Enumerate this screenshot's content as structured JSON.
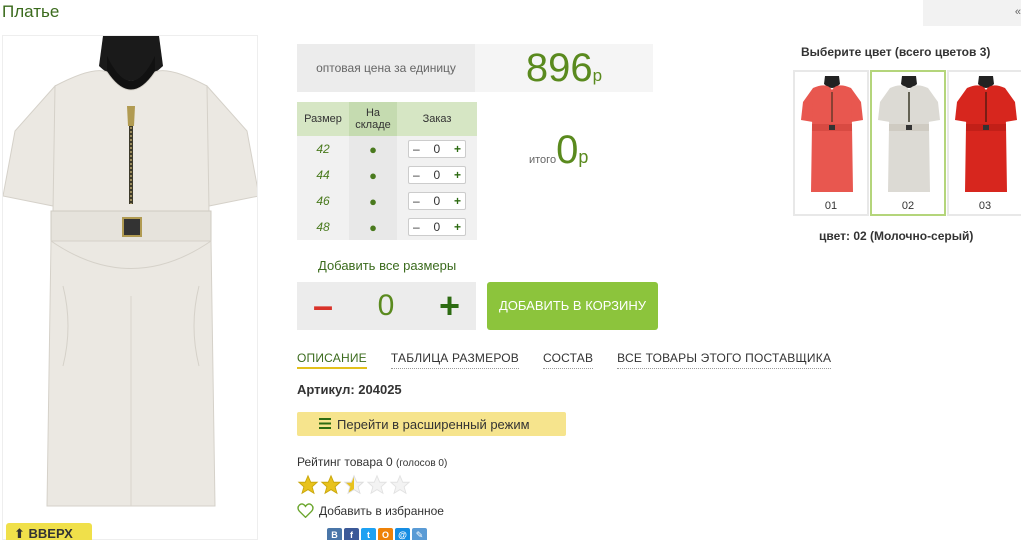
{
  "page": {
    "title": "Платье",
    "top_right_glyph": "«"
  },
  "price": {
    "label": "оптовая цена за единицу",
    "value": "896",
    "currency": "р"
  },
  "size_table": {
    "headers": [
      "Размер",
      "На складе",
      "Заказ"
    ],
    "rows": [
      {
        "size": "42",
        "stock": "●",
        "qty": "0"
      },
      {
        "size": "44",
        "stock": "●",
        "qty": "0"
      },
      {
        "size": "46",
        "stock": "●",
        "qty": "0"
      },
      {
        "size": "48",
        "stock": "●",
        "qty": "0"
      }
    ],
    "minus": "–",
    "plus": "+"
  },
  "total": {
    "label": "итого",
    "value": "0",
    "currency": "р"
  },
  "add_all_sizes": "Добавить все размеры",
  "big_qty": {
    "minus": "–",
    "value": "0",
    "plus": "+"
  },
  "cart_button": "ДОБАВИТЬ В КОРЗИНУ",
  "tabs": [
    "ОПИСАНИЕ",
    "ТАБЛИЦА РАЗМЕРОВ",
    "СОСТАВ",
    "ВСЕ ТОВАРЫ ЭТОГО ПОСТАВЩИКА"
  ],
  "artikul": "Артикул: 204025",
  "advanced_mode_button": "Перейти в расширенный режим",
  "rating": {
    "label": "Рейтинг товара 0",
    "votes": "(голосов 0)",
    "stars_filled": 2.5,
    "stars_total": 5
  },
  "favorite": "Добавить в избранное",
  "back_to_top": "⬆ ВВЕРХ",
  "colors": {
    "title": "Выберите цвет (всего цветов 3)",
    "items": [
      {
        "label": "01",
        "color": "#e8574f"
      },
      {
        "label": "02",
        "color": "#dcdad4"
      },
      {
        "label": "03",
        "color": "#d7261e"
      }
    ],
    "selected_index": 1,
    "selected_caption": "цвет: 02 (Молочно-серый)"
  },
  "social_icons": [
    "В",
    "f",
    "t",
    "О",
    "@",
    "✎"
  ],
  "colors_theme": {
    "accent_green": "#5a8a1e",
    "cart_green": "#8cc43c",
    "minus_red": "#d9332a",
    "advanced_yellow": "#f6e48d"
  }
}
